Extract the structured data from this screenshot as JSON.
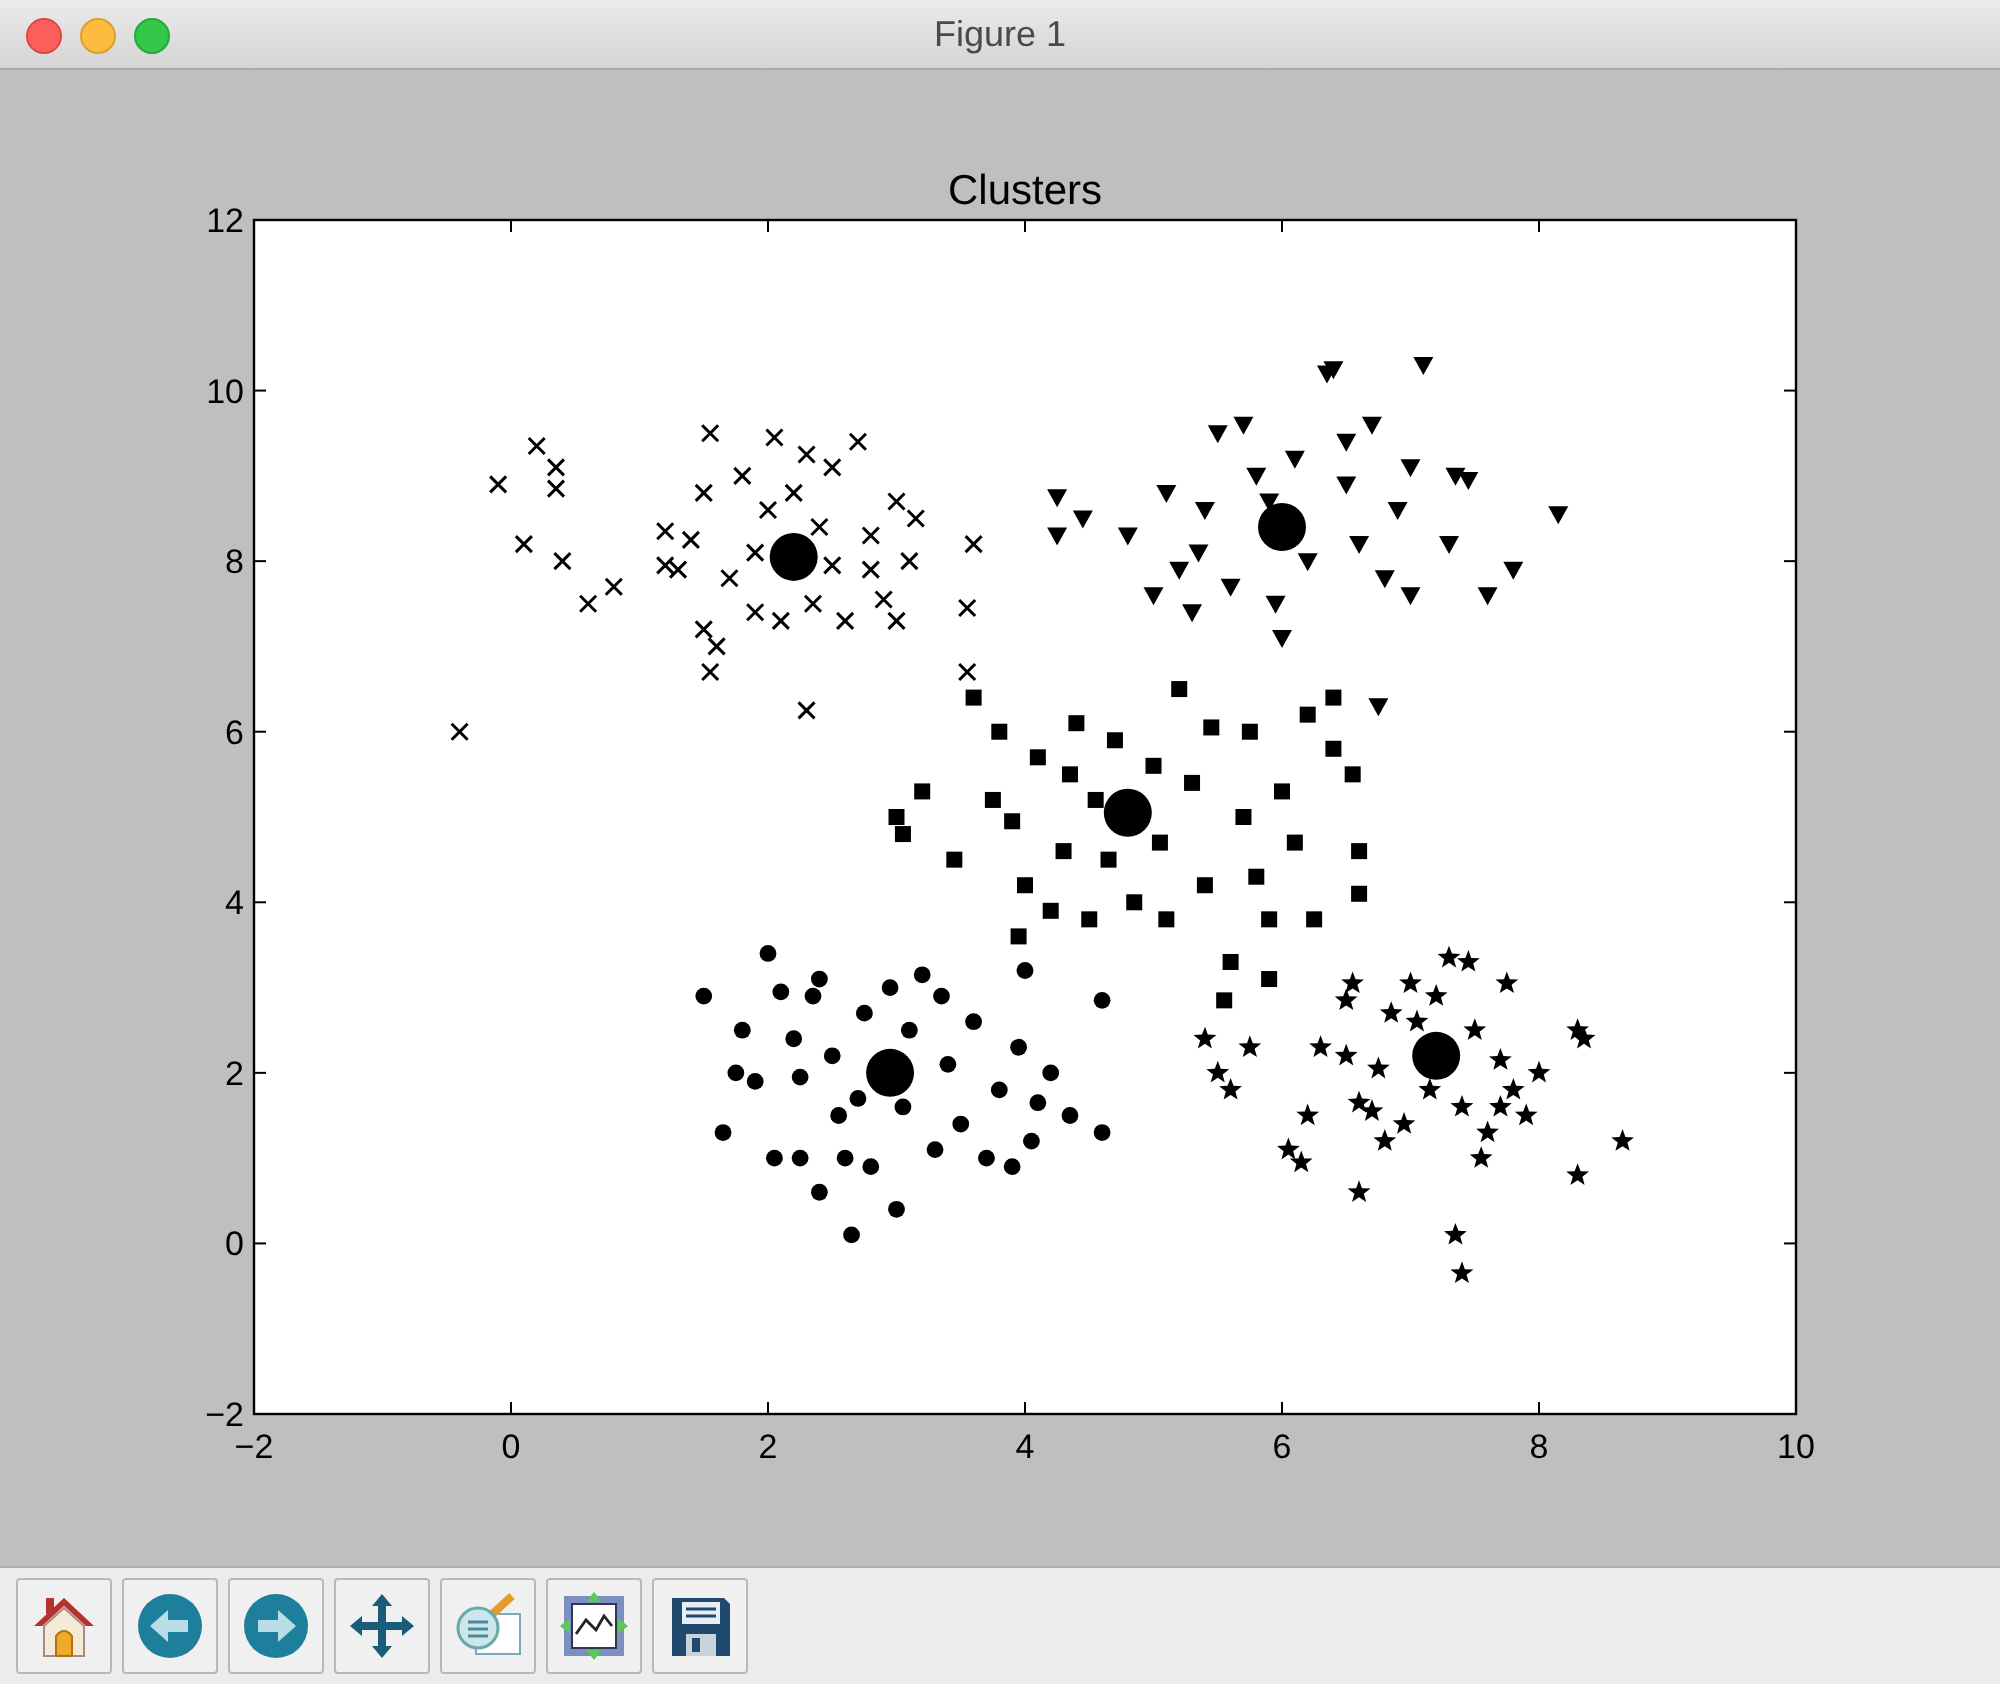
{
  "window": {
    "title": "Figure 1"
  },
  "figure": {
    "chart_data": {
      "type": "scatter",
      "title": "Clusters",
      "xlim": [
        -2,
        10
      ],
      "ylim": [
        -2,
        12
      ],
      "xticks": [
        {
          "value": -2,
          "label": "−2"
        },
        {
          "value": 0,
          "label": "0"
        },
        {
          "value": 2,
          "label": "2"
        },
        {
          "value": 4,
          "label": "4"
        },
        {
          "value": 6,
          "label": "6"
        },
        {
          "value": 8,
          "label": "8"
        },
        {
          "value": 10,
          "label": "10"
        }
      ],
      "yticks": [
        {
          "value": -2,
          "label": "−2"
        },
        {
          "value": 0,
          "label": "0"
        },
        {
          "value": 2,
          "label": "2"
        },
        {
          "value": 4,
          "label": "4"
        },
        {
          "value": 6,
          "label": "6"
        },
        {
          "value": 8,
          "label": "8"
        },
        {
          "value": 10,
          "label": "10"
        },
        {
          "value": 12,
          "label": "12"
        }
      ],
      "series": [
        {
          "color": "#000000",
          "x": [
            -0.4,
            -0.1,
            0.1,
            0.2,
            0.35,
            0.35,
            0.4,
            0.6,
            0.8,
            1.2,
            1.2,
            1.4,
            1.5,
            1.55,
            1.5,
            1.6,
            1.55,
            1.7,
            1.8,
            1.9,
            1.9,
            2.0,
            2.05,
            2.1,
            2.2,
            2.3,
            2.3,
            2.35,
            2.4,
            2.5,
            2.5,
            2.6,
            2.7,
            2.8,
            2.9,
            3.0,
            3.1,
            3.15,
            3.0,
            3.6,
            3.55,
            3.55,
            1.3,
            2.8
          ],
          "values": [
            6.0,
            8.9,
            8.2,
            9.35,
            9.1,
            8.85,
            8.0,
            7.5,
            7.7,
            8.35,
            7.95,
            8.25,
            8.8,
            9.5,
            7.2,
            7.0,
            6.7,
            7.8,
            9.0,
            8.1,
            7.4,
            8.6,
            9.45,
            7.3,
            8.8,
            9.25,
            6.25,
            7.5,
            8.4,
            7.95,
            9.1,
            7.3,
            9.4,
            8.3,
            7.55,
            8.7,
            8.0,
            8.5,
            7.3,
            8.2,
            7.45,
            6.7,
            7.9,
            7.9
          ]
        },
        {
          "color": "#000000",
          "x": [
            4.25,
            4.25,
            4.45,
            4.8,
            5.0,
            5.1,
            5.2,
            5.3,
            5.35,
            5.5,
            5.6,
            5.7,
            5.8,
            5.9,
            5.95,
            6.0,
            6.1,
            6.2,
            6.35,
            6.4,
            6.5,
            6.6,
            6.7,
            6.8,
            6.9,
            7.0,
            7.1,
            7.0,
            7.3,
            7.35,
            7.45,
            7.6,
            7.8,
            8.15,
            6.75,
            5.4,
            6.5
          ],
          "values": [
            8.75,
            8.3,
            8.5,
            8.3,
            7.6,
            8.8,
            7.9,
            7.4,
            8.1,
            9.5,
            7.7,
            9.6,
            9.0,
            8.7,
            7.5,
            7.1,
            9.2,
            8.0,
            10.2,
            10.25,
            9.4,
            8.2,
            9.6,
            7.8,
            8.6,
            9.1,
            10.3,
            7.6,
            8.2,
            9.0,
            8.95,
            7.6,
            7.9,
            8.55,
            6.3,
            8.6,
            8.9
          ]
        },
        {
          "color": "#000000",
          "x": [
            3.0,
            3.05,
            3.2,
            3.45,
            3.6,
            3.75,
            3.8,
            3.9,
            3.95,
            4.0,
            4.1,
            4.2,
            4.3,
            4.35,
            4.4,
            4.55,
            4.5,
            4.65,
            4.7,
            4.85,
            5.0,
            5.05,
            5.1,
            5.2,
            5.3,
            5.4,
            5.45,
            5.6,
            5.7,
            5.75,
            5.8,
            5.9,
            6.0,
            6.1,
            6.2,
            6.25,
            6.4,
            6.55,
            6.6,
            5.55,
            5.9,
            6.4,
            6.6
          ],
          "values": [
            5.0,
            4.8,
            5.3,
            4.5,
            6.4,
            5.2,
            6.0,
            4.95,
            3.6,
            4.2,
            5.7,
            3.9,
            4.6,
            5.5,
            6.1,
            5.2,
            3.8,
            4.5,
            5.9,
            4.0,
            5.6,
            4.7,
            3.8,
            6.5,
            5.4,
            4.2,
            6.05,
            3.3,
            5.0,
            6.0,
            4.3,
            3.8,
            5.3,
            4.7,
            6.2,
            3.8,
            5.8,
            5.5,
            4.1,
            2.85,
            3.1,
            6.4,
            4.6
          ]
        },
        {
          "color": "#000000",
          "x": [
            1.5,
            1.65,
            1.75,
            1.8,
            1.9,
            2.0,
            2.05,
            2.1,
            2.2,
            2.25,
            2.35,
            2.4,
            2.4,
            2.5,
            2.55,
            2.6,
            2.65,
            2.7,
            2.75,
            2.8,
            2.95,
            3.0,
            3.05,
            3.1,
            3.2,
            3.3,
            3.4,
            3.5,
            3.6,
            3.7,
            3.8,
            3.95,
            4.0,
            4.05,
            4.1,
            4.2,
            4.35,
            4.6,
            4.6,
            3.35,
            2.25,
            3.9
          ],
          "values": [
            2.9,
            1.3,
            2.0,
            2.5,
            1.9,
            3.4,
            1.0,
            2.95,
            2.4,
            1.0,
            2.9,
            0.6,
            3.1,
            2.2,
            1.5,
            1.0,
            0.1,
            1.7,
            2.7,
            0.9,
            3.0,
            0.4,
            1.6,
            2.5,
            3.15,
            1.1,
            2.1,
            1.4,
            2.6,
            1.0,
            1.8,
            2.3,
            3.2,
            1.2,
            1.65,
            2.0,
            1.5,
            2.85,
            1.3,
            2.9,
            1.95,
            0.9
          ]
        },
        {
          "color": "#000000",
          "x": [
            5.4,
            5.5,
            5.6,
            5.75,
            6.05,
            6.15,
            6.3,
            6.5,
            6.5,
            6.55,
            6.6,
            6.6,
            6.7,
            6.75,
            6.8,
            6.85,
            6.95,
            7.0,
            7.05,
            7.15,
            7.2,
            7.3,
            7.35,
            7.4,
            7.45,
            7.4,
            7.5,
            7.55,
            7.6,
            7.7,
            7.75,
            7.8,
            7.9,
            8.0,
            8.3,
            8.35,
            8.3,
            8.65,
            7.7,
            6.2
          ],
          "values": [
            2.4,
            2.0,
            1.8,
            2.3,
            1.1,
            0.95,
            2.3,
            2.85,
            2.2,
            3.05,
            1.65,
            0.6,
            1.55,
            2.05,
            1.2,
            2.7,
            1.4,
            3.05,
            2.6,
            1.8,
            2.9,
            3.35,
            0.1,
            1.6,
            3.3,
            -0.35,
            2.5,
            1.0,
            1.3,
            2.15,
            3.05,
            1.8,
            1.5,
            2.0,
            2.5,
            2.4,
            0.8,
            1.2,
            1.6,
            1.5
          ]
        },
        {
          "color": "#000000",
          "x": [
            2.2,
            6.0,
            4.8,
            2.95,
            7.2
          ],
          "values": [
            8.05,
            8.4,
            5.05,
            2.0,
            2.2
          ]
        }
      ]
    }
  },
  "series_markers": [
    {
      "kind": "cross"
    },
    {
      "kind": "triangle"
    },
    {
      "kind": "square"
    },
    {
      "kind": "circle"
    },
    {
      "kind": "star"
    },
    {
      "kind": "centroid"
    }
  ],
  "toolbar": [
    {
      "kind": "home"
    },
    {
      "kind": "back"
    },
    {
      "kind": "forward"
    },
    {
      "kind": "pan"
    },
    {
      "kind": "zoom"
    },
    {
      "kind": "subplots"
    },
    {
      "kind": "save"
    }
  ]
}
